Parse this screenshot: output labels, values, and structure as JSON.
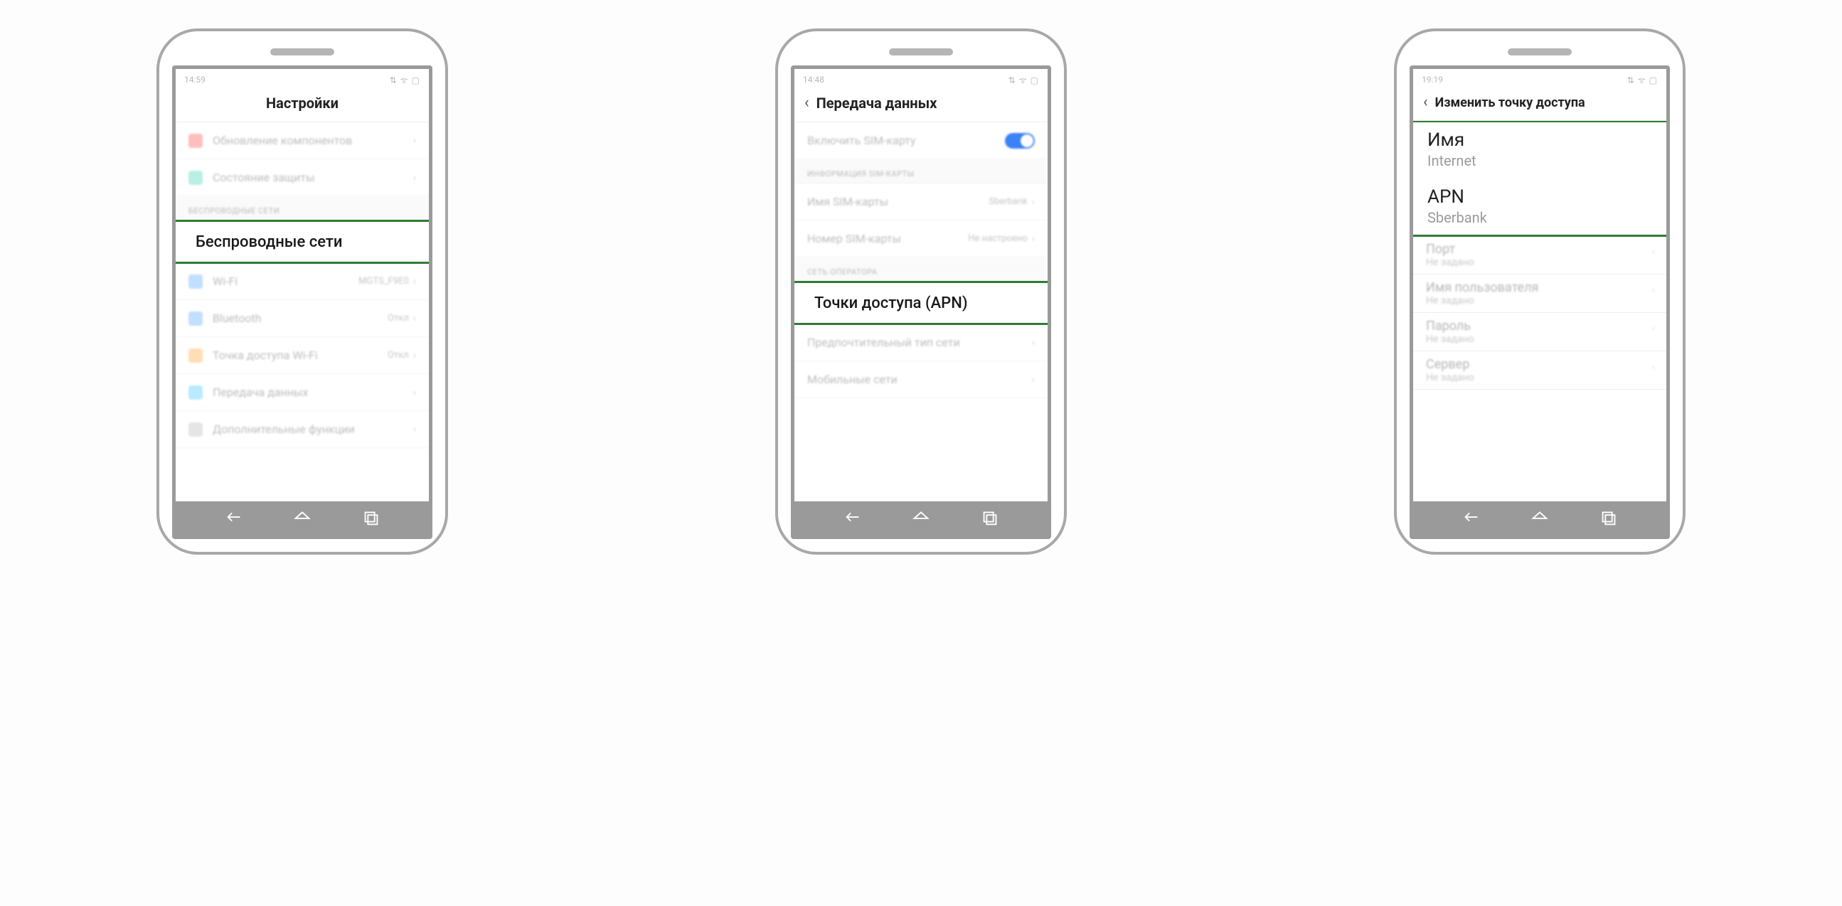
{
  "screen1": {
    "status_time": "14:59",
    "status_icons": "⇅ ᯤ ▢",
    "title": "Настройки",
    "rows": {
      "update": "Обновление компонентов",
      "security": "Состояние защиты"
    },
    "section_wireless": "БЕСПРОВОДНЫЕ СЕТИ",
    "highlight": "Беспроводные сети",
    "wifi_label": "Wi-Fi",
    "wifi_value": "MGTS_F9E0",
    "bt_label": "Bluetooth",
    "bt_value": "Откл",
    "hotspot_label": "Точка доступа Wi-Fi",
    "hotspot_value": "Откл",
    "data_label": "Передача данных",
    "more_label": "Дополнительные функции"
  },
  "screen2": {
    "status_time": "14:48",
    "status_icons": "⇅ ᯤ ▢",
    "title": "Передача данных",
    "sim_toggle": "Включить SIM-карту",
    "section_sim": "ИНФОРМАЦИЯ SIM-КАРТЫ",
    "sim_name_label": "Имя SIM-карты",
    "sim_name_value": "Sberbank",
    "sim_num_label": "Номер SIM-карты",
    "sim_num_value": "Не настроено",
    "section_net": "СЕТЬ ОПЕРАТОРА",
    "highlight": "Точки доступа (APN)",
    "pref_net": "Предпочтительный тип сети",
    "mobile_net": "Мобильные сети"
  },
  "screen3": {
    "status_time": "19:19",
    "status_icons": "⇅ ᯤ ▢",
    "title": "Изменить точку доступа",
    "name_label": "Имя",
    "name_value": "Internet",
    "apn_label": "APN",
    "apn_value": "Sberbank",
    "port_label": "Порт",
    "port_value": "Не задано",
    "user_label": "Имя пользователя",
    "user_value": "Не задано",
    "pass_label": "Пароль",
    "pass_value": "Не задано",
    "server_label": "Сервер",
    "server_value": "Не задано"
  }
}
